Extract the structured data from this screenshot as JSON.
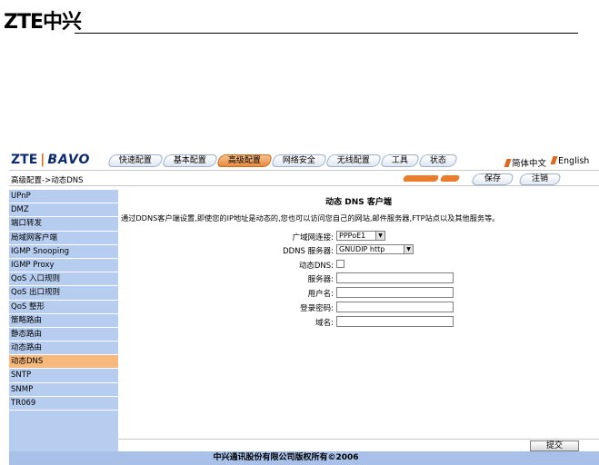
{
  "doc": {
    "logo": "ZTE中兴"
  },
  "brand": {
    "zte": "ZTE",
    "bavo": "BAVO"
  },
  "tabs": [
    {
      "label": "快速配置"
    },
    {
      "label": "基本配置"
    },
    {
      "label": "高级配置",
      "active": true
    },
    {
      "label": "网络安全"
    },
    {
      "label": "无线配置"
    },
    {
      "label": "工具"
    },
    {
      "label": "状态"
    }
  ],
  "lang": {
    "chinese": "简体中文",
    "english": "English"
  },
  "breadcrumb": "高级配置->动态DNS",
  "actions": {
    "save": "保存",
    "logout": "注销"
  },
  "sidebar": {
    "items": [
      {
        "label": "UPnP"
      },
      {
        "label": "DMZ"
      },
      {
        "label": "端口转发"
      },
      {
        "label": "局域网客户端"
      },
      {
        "label": "IGMP Snooping"
      },
      {
        "label": "IGMP Proxy"
      },
      {
        "label": "QoS 入口规则"
      },
      {
        "label": "QoS 出口规则"
      },
      {
        "label": "QoS 整形"
      },
      {
        "label": "策略路由"
      },
      {
        "label": "静态路由"
      },
      {
        "label": "动态路由"
      },
      {
        "label": "动态DNS",
        "active": true
      },
      {
        "label": "SNTP"
      },
      {
        "label": "SNMP"
      },
      {
        "label": "TR069"
      }
    ]
  },
  "main": {
    "title": "动态 DNS 客户端",
    "description": "通过DDNS客户端设置,即使您的IP地址是动态的,您也可以访问您自己的网站,邮件服务器,FTP站点以及其他服务等。",
    "fields": {
      "wan_label": "广域网连接:",
      "wan_value": "PPPoE1",
      "ddns_server_label": "DDNS 服务器:",
      "ddns_server_value": "GNUDIP http",
      "dynamic_dns_label": "动态DNS:",
      "server_label": "服务器:",
      "username_label": "用户名:",
      "password_label": "登录密码:",
      "domain_label": "域名:"
    },
    "submit": "提交"
  },
  "footer": "中兴通讯股份有限公司版权所有©2006",
  "colors": {
    "sidebar": "#b6cdef",
    "accent": "#ea8a3e",
    "footer": "#a9c1e8"
  }
}
